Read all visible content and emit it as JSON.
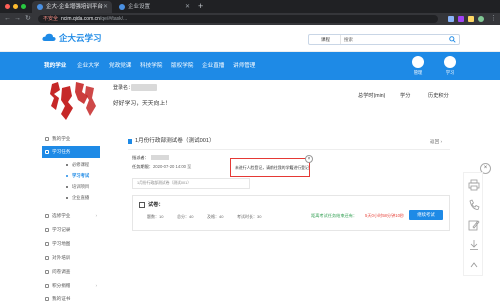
{
  "browser": {
    "tabs": [
      {
        "title": "企大-企业增强培训平台",
        "active": true
      },
      {
        "title": "企业设置",
        "active": false
      }
    ],
    "security_label": "不安全",
    "url_host": "ncim.qida.com.cn",
    "url_path": "/qe/#/task/..."
  },
  "site": {
    "logo_text": "企大云学习",
    "search": {
      "category": "课程",
      "placeholder": "搜索"
    },
    "nav": [
      "我的学业",
      "企业大学",
      "党政党课",
      "科技学院",
      "版权学院",
      "企业直播",
      "讲师管理"
    ],
    "nav_icons": [
      {
        "label": "管理",
        "icon": "manage-icon"
      },
      {
        "label": "学习",
        "icon": "study-icon"
      }
    ]
  },
  "profile": {
    "account_label": "登录名：",
    "motto": "好好学习，天天向上！",
    "stats": [
      "总学时(min)",
      "学分",
      "历史积分"
    ]
  },
  "sidebar": {
    "items": [
      {
        "label": "我的学业",
        "icon": "book-icon"
      },
      {
        "label": "学习任务",
        "icon": "task-icon",
        "active": true
      },
      {
        "label": "选修学业",
        "icon": "elective-icon"
      },
      {
        "label": "学习记录",
        "icon": "record-icon"
      },
      {
        "label": "学习地图",
        "icon": "map-icon"
      },
      {
        "label": "对外培训",
        "icon": "training-icon"
      },
      {
        "label": "问卷调查",
        "icon": "survey-icon"
      },
      {
        "label": "积分捐赠",
        "icon": "points-icon"
      },
      {
        "label": "我的证书",
        "icon": "certificate-icon"
      }
    ],
    "sub_items": [
      {
        "label": "必修课程"
      },
      {
        "label": "学习考试",
        "current": true
      },
      {
        "label": "培训项目"
      },
      {
        "label": "企业直播"
      }
    ]
  },
  "main": {
    "title": "1月份行政部测试卷（测试001）",
    "back": "返回",
    "rows": [
      {
        "label": "指派者："
      },
      {
        "label": "任务期限：",
        "value": "2020-07-20 14:00 至"
      }
    ],
    "notice": "1月份行政部测试卷（测试001）",
    "paper": {
      "heading": "试卷：",
      "stats": [
        "题数：",
        "总分：",
        "及格：",
        "考试时长："
      ],
      "values": [
        "10",
        "40",
        "40",
        "30"
      ],
      "status": "距离考试任务结束还有：",
      "remaining": "5天0小时58分钟10秒",
      "button": "继续考试"
    }
  },
  "tip": {
    "text": "未进行人脸登记，请前往我的学籍进行登记"
  },
  "float_tools": [
    "print-icon",
    "phone-icon",
    "edit-icon",
    "download-icon",
    "up-icon"
  ],
  "colors": {
    "brand": "#1e8ae6",
    "alert_border": "#e53935",
    "success": "#2e9d4f",
    "warning": "#e8453c"
  }
}
